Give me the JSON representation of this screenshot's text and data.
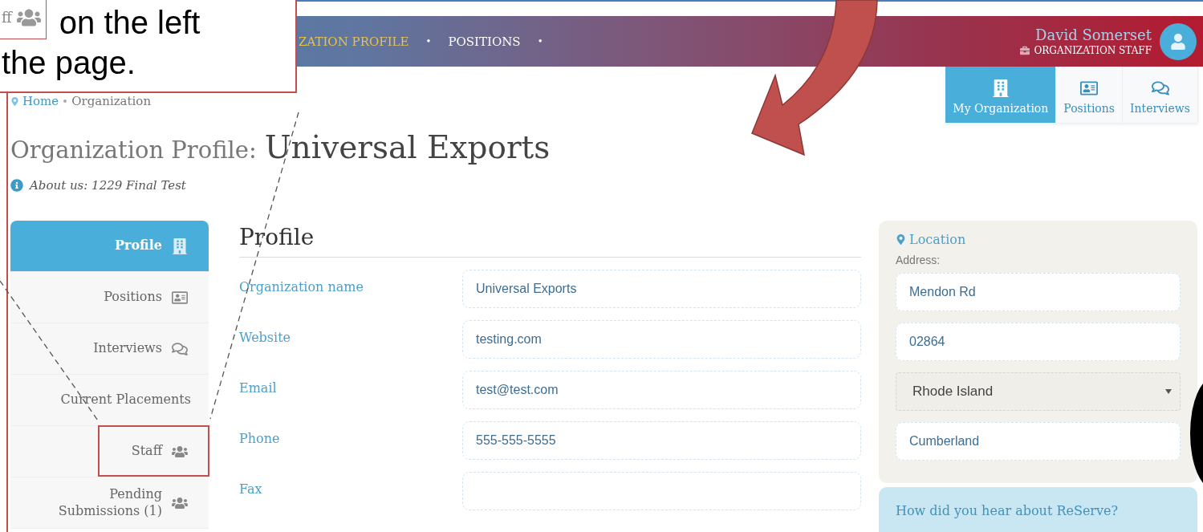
{
  "callout": {
    "chip_text": "ff",
    "line_1": "on the left",
    "line_2": "the page."
  },
  "header": {
    "nav": [
      {
        "label": "ZATION PROFILE",
        "selected": true,
        "separator": "•"
      },
      {
        "label": "POSITIONS",
        "selected": false,
        "separator": "•"
      }
    ],
    "user": {
      "name": "David Somerset",
      "role": "ORGANIZATION STAFF"
    }
  },
  "tabs": [
    {
      "label": "My Organization",
      "selected": true,
      "kind": "building"
    },
    {
      "label": "Positions",
      "selected": false,
      "kind": "card"
    },
    {
      "label": "Interviews",
      "selected": false,
      "kind": "chat"
    }
  ],
  "breadcrumb": [
    {
      "label": "Home",
      "kind": "link"
    },
    {
      "label": "Organization",
      "kind": "current"
    }
  ],
  "title": {
    "prefix": "Organization Profile:",
    "name": "Universal Exports"
  },
  "about": "About us: 1229 Final Test",
  "sidebar": [
    {
      "label": "Profile",
      "selected": true,
      "kind": "building",
      "annotated": false
    },
    {
      "label": "Positions",
      "selected": false,
      "kind": "card",
      "annotated": false
    },
    {
      "label": "Interviews",
      "selected": false,
      "kind": "chat",
      "annotated": false
    },
    {
      "label": "Current Placements",
      "selected": false,
      "kind": "none",
      "annotated": false
    },
    {
      "label": "Staff",
      "selected": false,
      "kind": "users",
      "annotated": true
    },
    {
      "label": "Pending Submissions (1)",
      "selected": false,
      "kind": "users",
      "annotated": false
    }
  ],
  "profile": {
    "heading": "Profile",
    "fields": [
      {
        "label": "Organization name",
        "value": "Universal Exports"
      },
      {
        "label": "Website",
        "value": "testing.com"
      },
      {
        "label": "Email",
        "value": "test@test.com"
      },
      {
        "label": "Phone",
        "value": "555-555-5555"
      },
      {
        "label": "Fax"
      }
    ]
  },
  "location": {
    "heading": "Location",
    "address_label": "Address:",
    "street": "Mendon Rd",
    "zip": "02864",
    "state": "Rhode Island",
    "city": "Cumberland"
  },
  "referral": {
    "heading": "How did you hear about ReServe?"
  }
}
